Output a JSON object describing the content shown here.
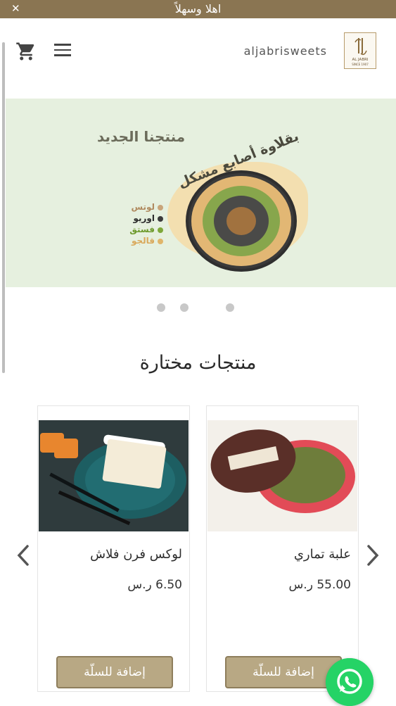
{
  "top_bar": {
    "close_icon": "close-icon",
    "welcome_text": "اهلا وسهلاً"
  },
  "header": {
    "brand_name": "aljabrisweets",
    "logo_name": "AL JABRI",
    "logo_since": "SINCE 1907",
    "icons": {
      "cart": "shopping-cart-icon",
      "menu": "hamburger-menu-icon"
    }
  },
  "banner": {
    "title": "منتجنا الجديد",
    "product_headline": "بقلاوة أصابع مشكل",
    "flavors": [
      {
        "label": "لوتس",
        "color": "#c9a57a"
      },
      {
        "label": "اوريو",
        "color": "#3b3b3b"
      },
      {
        "label": "فستق",
        "color": "#7ea83a"
      },
      {
        "label": "قالجو",
        "color": "#e0b56a"
      }
    ]
  },
  "featured": {
    "title": "منتجات مختارة",
    "currency": "ر.س",
    "products": [
      {
        "name": "علبة تماري",
        "price": "55.00",
        "button_label": "إضافة للسلّة"
      },
      {
        "name": "لوكس فرن فلاش",
        "price": "6.50",
        "button_label": "إضافة للسلّة"
      }
    ]
  },
  "colors": {
    "brand": "#8a7552",
    "banner_bg": "#e6f0df",
    "button": "#b8a884",
    "whatsapp": "#25d366"
  }
}
